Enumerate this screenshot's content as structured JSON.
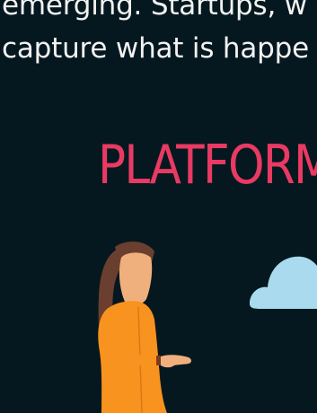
{
  "intro": {
    "line1": "emerging. Startups, w",
    "line2": "capture what is happe"
  },
  "section": {
    "heading": "PLATFORM"
  },
  "colors": {
    "background": "#06181f",
    "accent": "#e83a63",
    "text": "#f2f2f2",
    "dress": "#f7931e",
    "hair": "#6b3f2f",
    "skin": "#f0b07e",
    "cloud": "#a9daee"
  },
  "illustration": {
    "person": "woman-in-orange-dress",
    "cloud": "cloud-icon"
  }
}
